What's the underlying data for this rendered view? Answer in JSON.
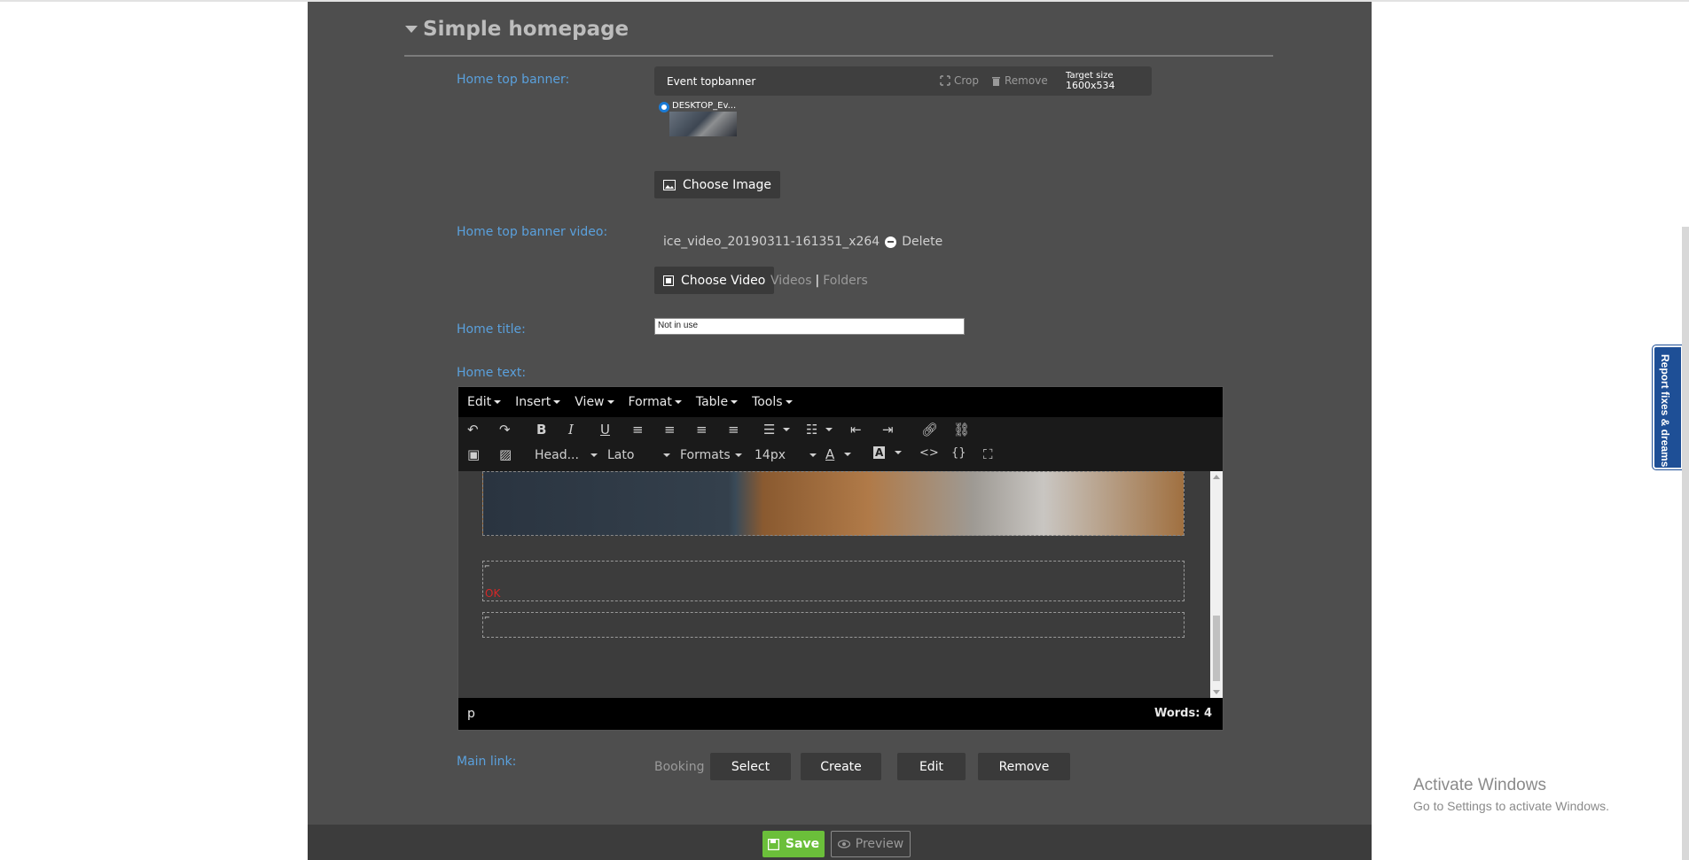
{
  "section": {
    "title": "Simple homepage"
  },
  "fields": {
    "top_banner_label": "Home top banner:",
    "top_banner_video_label": "Home top banner video:",
    "home_title_label": "Home title:",
    "home_text_label": "Home text:",
    "main_link_label": "Main link:"
  },
  "image_bar": {
    "title": "Event topbanner",
    "crop": "Crop",
    "remove": "Remove",
    "target_label": "Target size",
    "target_size": "1600x534",
    "thumb_label": "DESKTOP_Ev..."
  },
  "choose_image": "Choose Image",
  "video": {
    "filename": "ice_video_20190311-161351_x264",
    "delete": "Delete",
    "choose": "Choose Video",
    "videos_link": "Videos",
    "separator": "|",
    "folders_link": "Folders"
  },
  "home_title_value": "Not in use",
  "editor": {
    "menus": [
      "Edit",
      "Insert",
      "View",
      "Format",
      "Table",
      "Tools"
    ],
    "heading_select": "Head...",
    "font_select": "Lato",
    "formats_select": "Formats",
    "size_select": "14px",
    "content_ok": "OK",
    "status_path": "p",
    "words": "Words: 4"
  },
  "main_link": {
    "type": "Booking",
    "buttons": [
      "Select",
      "Create",
      "Edit",
      "Remove"
    ]
  },
  "footer": {
    "save": "Save",
    "preview": "Preview"
  },
  "report_tab": "Report fixes & dreams",
  "watermark": {
    "line1": "Activate Windows",
    "line2": "Go to Settings to activate Windows."
  }
}
